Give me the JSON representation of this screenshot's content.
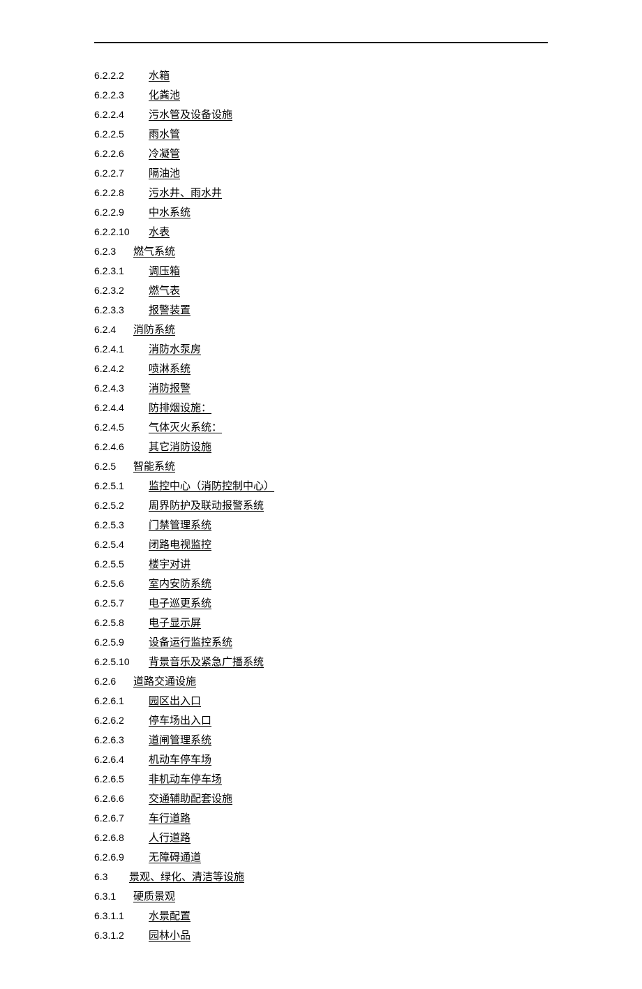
{
  "toc": [
    {
      "num": "6.2.2.2",
      "cls": "lv3",
      "title": "水箱"
    },
    {
      "num": "6.2.2.3",
      "cls": "lv3",
      "title": "化粪池"
    },
    {
      "num": "6.2.2.4",
      "cls": "lv3",
      "title": "污水管及设备设施"
    },
    {
      "num": "6.2.2.5",
      "cls": "lv3",
      "title": "雨水管"
    },
    {
      "num": "6.2.2.6",
      "cls": "lv3",
      "title": "冷凝管"
    },
    {
      "num": "6.2.2.7",
      "cls": "lv3",
      "title": "隔油池"
    },
    {
      "num": "6.2.2.8",
      "cls": "lv3",
      "title": "污水井、雨水井"
    },
    {
      "num": "6.2.2.9",
      "cls": "lv3",
      "title": "中水系统"
    },
    {
      "num": "6.2.2.10",
      "cls": "lv3w",
      "title": "水表"
    },
    {
      "num": "6.2.3",
      "cls": "lv2",
      "title": "燃气系统"
    },
    {
      "num": "6.2.3.1",
      "cls": "lv3",
      "title": "调压箱"
    },
    {
      "num": "6.2.3.2",
      "cls": "lv3",
      "title": "燃气表"
    },
    {
      "num": "6.2.3.3",
      "cls": "lv3",
      "title": "报警装置"
    },
    {
      "num": "6.2.4",
      "cls": "lv2",
      "title": "消防系统 "
    },
    {
      "num": "6.2.4.1",
      "cls": "lv3",
      "title": "消防水泵房"
    },
    {
      "num": "6.2.4.2",
      "cls": "lv3",
      "title": "喷淋系统"
    },
    {
      "num": "6.2.4.3",
      "cls": "lv3",
      "title": "消防报警"
    },
    {
      "num": "6.2.4.4",
      "cls": "lv3",
      "title": "防排烟设施： "
    },
    {
      "num": "6.2.4.5",
      "cls": "lv3",
      "title": "气体灭火系统： "
    },
    {
      "num": "6.2.4.6",
      "cls": "lv3",
      "title": "其它消防设施"
    },
    {
      "num": "6.2.5",
      "cls": "lv2",
      "title": "智能系统 "
    },
    {
      "num": "6.2.5.1",
      "cls": "lv3",
      "title": "监控中心（消防控制中心）"
    },
    {
      "num": "6.2.5.2",
      "cls": "lv3",
      "title": "周界防护及联动报警系统 "
    },
    {
      "num": "6.2.5.3",
      "cls": "lv3",
      "title": "门禁管理系统"
    },
    {
      "num": "6.2.5.4",
      "cls": "lv3",
      "title": "闭路电视监控"
    },
    {
      "num": "6.2.5.5",
      "cls": "lv3",
      "title": "楼宇对讲"
    },
    {
      "num": "6.2.5.6",
      "cls": "lv3",
      "title": "室内安防系统 "
    },
    {
      "num": "6.2.5.7",
      "cls": "lv3",
      "title": "电子巡更系统"
    },
    {
      "num": "6.2.5.8",
      "cls": "lv3",
      "title": "电子显示屏"
    },
    {
      "num": "6.2.5.9",
      "cls": "lv3",
      "title": "设备运行监控系统 "
    },
    {
      "num": "6.2.5.10",
      "cls": "lv3w",
      "title": "背景音乐及紧急广播系统 "
    },
    {
      "num": "6.2.6",
      "cls": "lv2",
      "title": "道路交通设施 "
    },
    {
      "num": "6.2.6.1",
      "cls": "lv3",
      "title": "园区出入口"
    },
    {
      "num": "6.2.6.2",
      "cls": "lv3",
      "title": "停车场出入口"
    },
    {
      "num": "6.2.6.3",
      "cls": "lv3",
      "title": "道闸管理系统 "
    },
    {
      "num": "6.2.6.4",
      "cls": "lv3",
      "title": "机动车停车场 "
    },
    {
      "num": "6.2.6.5",
      "cls": "lv3",
      "title": "非机动车停车场 "
    },
    {
      "num": "6.2.6.6",
      "cls": "lv3",
      "title": "交通辅助配套设施"
    },
    {
      "num": "6.2.6.7",
      "cls": "lv3",
      "title": "车行道路"
    },
    {
      "num": "6.2.6.8",
      "cls": "lv3",
      "title": "人行道路 "
    },
    {
      "num": "6.2.6.9",
      "cls": "lv3",
      "title": "无障碍通道"
    },
    {
      "num": "6.3",
      "cls": "lv1",
      "title": "景观、绿化、清洁等设施 "
    },
    {
      "num": "6.3.1",
      "cls": "lv2",
      "title": "硬质景观 "
    },
    {
      "num": "6.3.1.1",
      "cls": "lv3",
      "title": "水景配置 "
    },
    {
      "num": "6.3.1.2",
      "cls": "lv3",
      "title": "园林小品 "
    }
  ]
}
